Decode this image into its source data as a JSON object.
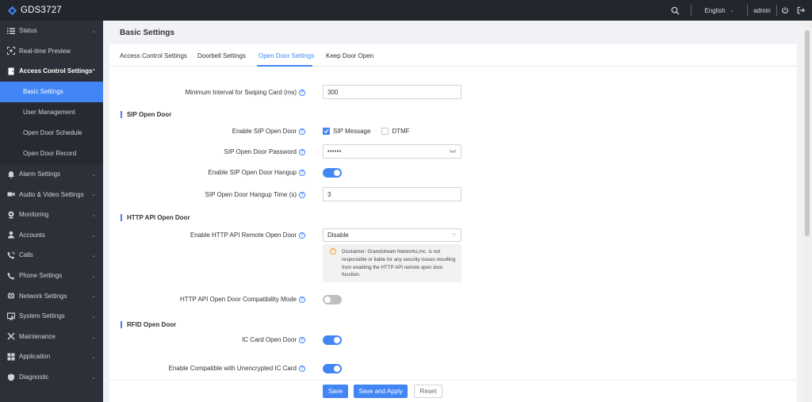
{
  "app": {
    "title": "GDS3727"
  },
  "topbar": {
    "language": "English",
    "user": "admin"
  },
  "sidebar": {
    "items": [
      {
        "label": "Status",
        "icon": "list-icon"
      },
      {
        "label": "Real-time Preview",
        "icon": "camera-preview-icon"
      },
      {
        "label": "Access Control Settings",
        "icon": "door-icon"
      }
    ],
    "sub_items": [
      {
        "label": "Basic Settings"
      },
      {
        "label": "User Management"
      },
      {
        "label": "Open Door Schedule"
      },
      {
        "label": "Open Door Record"
      }
    ],
    "items_after": [
      {
        "label": "Alarm Settings",
        "icon": "alarm-icon"
      },
      {
        "label": "Audio & Video Settings",
        "icon": "video-icon"
      },
      {
        "label": "Monitoring",
        "icon": "monitoring-icon"
      },
      {
        "label": "Accounts",
        "icon": "user-icon"
      },
      {
        "label": "Calls",
        "icon": "calls-icon"
      },
      {
        "label": "Phone Settings",
        "icon": "phone-icon"
      },
      {
        "label": "Network Settings",
        "icon": "globe-icon"
      },
      {
        "label": "System Settings",
        "icon": "system-icon"
      },
      {
        "label": "Maintenance",
        "icon": "tools-icon"
      },
      {
        "label": "Application",
        "icon": "grid-icon"
      },
      {
        "label": "Diagnostic",
        "icon": "shield-icon"
      }
    ]
  },
  "page": {
    "title": "Basic Settings"
  },
  "tabs": [
    {
      "label": "Access Control Settings"
    },
    {
      "label": "Doorbell Settings"
    },
    {
      "label": "Open Door Settings"
    },
    {
      "label": "Keep Door Open"
    }
  ],
  "form": {
    "min_interval": {
      "label": "Minimum Interval for Swiping Card (ms)",
      "value": "300"
    },
    "sip_section": "SIP Open Door",
    "enable_sip": {
      "label": "Enable SIP Open Door",
      "opt1": "SIP Message",
      "opt2": "DTMF"
    },
    "sip_password": {
      "label": "SIP Open Door Password",
      "value": "••••••"
    },
    "sip_hangup": {
      "label": "Enable SIP Open Door Hangup"
    },
    "sip_hangup_time": {
      "label": "SIP Open Door Hangup Time (s)",
      "value": "3"
    },
    "http_section": "HTTP API Open Door",
    "http_remote": {
      "label": "Enable HTTP API Remote Open Door",
      "value": "Disable"
    },
    "disclaimer": "Disclaimer: Grandstream Networks,Inc. is not responsible or liable for any security issues resulting from enabling the HTTP API remote open door function.",
    "http_compat": {
      "label": "HTTP API Open Door Compatibility Mode"
    },
    "rfid_section": "RFID Open Door",
    "ic_card": {
      "label": "IC Card Open Door"
    },
    "unencrypted": {
      "label": "Enable Compatible with Unencrypted IC Card"
    }
  },
  "footer": {
    "save": "Save",
    "save_apply": "Save and Apply",
    "reset": "Reset"
  },
  "colors": {
    "accent": "#4285f4",
    "sidebar_bg": "#2c3039",
    "topbar_bg": "#22262d"
  }
}
